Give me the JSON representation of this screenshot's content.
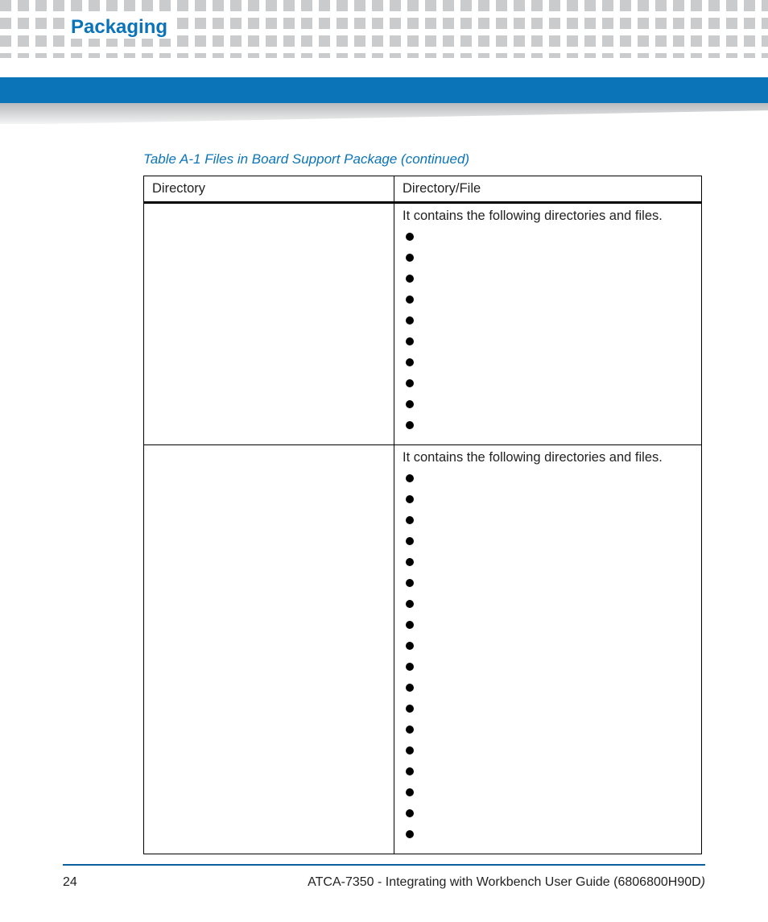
{
  "header": {
    "section_title": "Packaging"
  },
  "table": {
    "caption": "Table A-1 Files in Board Support Package (continued)",
    "columns": {
      "col1": "Directory",
      "col2": "Directory/File"
    },
    "rows": [
      {
        "directory": "",
        "intro": "It contains the following directories and files.",
        "bullet_count": 10
      },
      {
        "directory": "",
        "intro": "It contains the following directories and files.",
        "bullet_count": 18
      }
    ]
  },
  "footer": {
    "page_number": "24",
    "doc_title": "ATCA-7350 - Integrating with Workbench User Guide (6806800H90D",
    "closing_paren": ")"
  }
}
